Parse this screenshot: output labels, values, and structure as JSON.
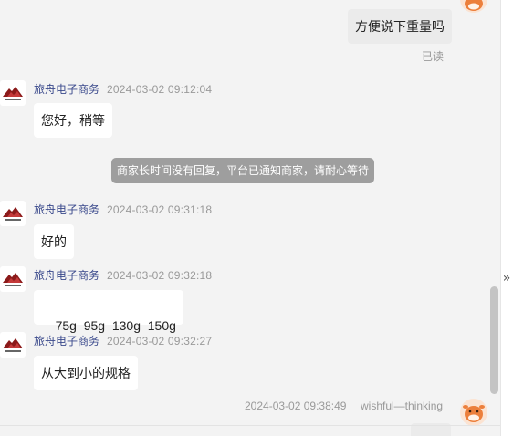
{
  "conversation": {
    "my_earlier_message": {
      "text": "方便说下重量吗",
      "status": "已读"
    },
    "system_notice": "商家长时间没有回复，平台已通知商家，请耐心等待",
    "shop_messages": [
      {
        "sender": "旅舟电子商务",
        "time": "2024-03-02 09:12:04",
        "text": "您好，稍等"
      },
      {
        "sender": "旅舟电子商务",
        "time": "2024-03-02 09:31:18",
        "text": "好的"
      },
      {
        "sender": "旅舟电子商务",
        "time": "2024-03-02 09:32:18",
        "text": "75g  95g  130g  150g"
      },
      {
        "sender": "旅舟电子商务",
        "time": "2024-03-02 09:32:27",
        "text": "从大到小的规格"
      }
    ],
    "my_latest": {
      "time": "2024-03-02 09:38:49",
      "name": "wishful—thinking"
    }
  },
  "icons": {
    "shop_avatar": "shop-logo-icon",
    "user_avatar": "cow-avatar-icon",
    "collapse": "double-chevron-right-icon"
  },
  "colors": {
    "background": "#f3f3f3",
    "sender_name": "#3b4a8c",
    "notice_bg": "#9e9e9e",
    "user_avatar": "#ec7f3b"
  }
}
